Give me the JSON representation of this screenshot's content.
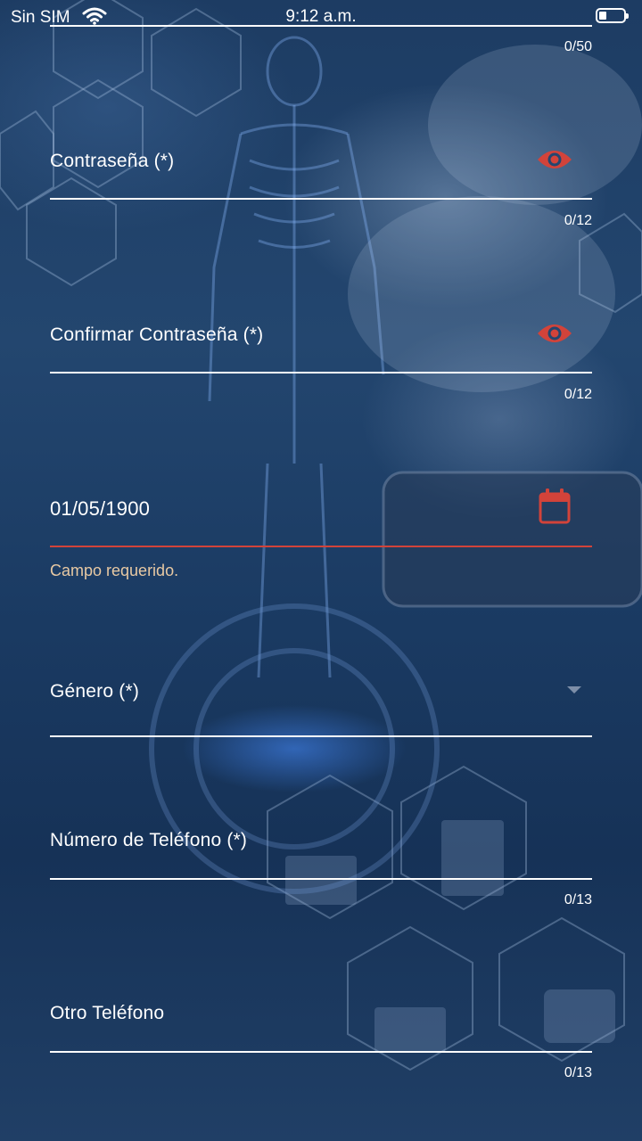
{
  "status_bar": {
    "carrier": "Sin SIM",
    "time": "9:12 a.m."
  },
  "form": {
    "email": {
      "counter": "0/50"
    },
    "password": {
      "label": "Contraseña (*)",
      "counter": "0/12",
      "icon": "eye-icon"
    },
    "confirm_password": {
      "label": "Confirmar Contraseña (*)",
      "counter": "0/12",
      "icon": "eye-icon"
    },
    "birthdate": {
      "value": "01/05/1900",
      "error": "Campo requerido.",
      "icon": "calendar-icon"
    },
    "gender": {
      "label": "Género (*)",
      "icon": "dropdown-arrow-icon"
    },
    "phone": {
      "label": "Número de Teléfono (*)",
      "counter": "0/13"
    },
    "other_phone": {
      "label": "Otro Teléfono",
      "counter": "0/13"
    }
  },
  "colors": {
    "accent_red": "#d2433a",
    "underline": "#ffffff",
    "error_text": "#e8c9a3",
    "background": "#1d3c63"
  }
}
